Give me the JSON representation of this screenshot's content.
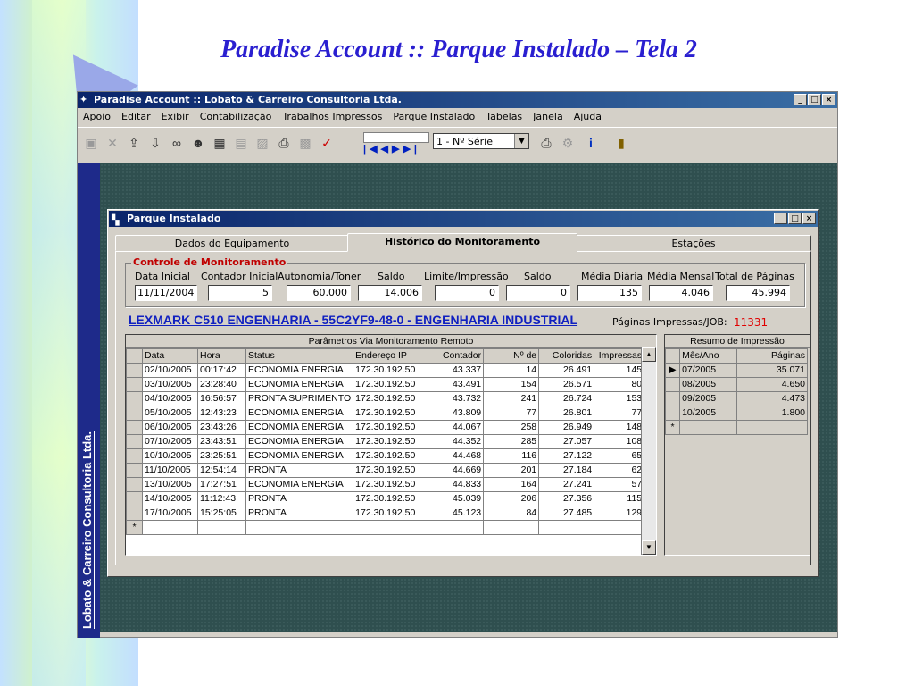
{
  "slide": {
    "title": "Paradise Account :: Parque Instalado – Tela 2"
  },
  "app": {
    "title": "Paradise Account :: Lobato & Carreiro Consultoria Ltda.",
    "side_label": "Lobato & Carreiro Consultoria Ltda.",
    "menu": [
      "Apoio",
      "Editar",
      "Exibir",
      "Contabilização",
      "Trabalhos Impressos",
      "Parque Instalado",
      "Tabelas",
      "Janela",
      "Ajuda"
    ],
    "combo_value": "1 - Nº Série",
    "window_buttons": [
      "_",
      "□",
      "×"
    ]
  },
  "child": {
    "title": "Parque Instalado",
    "tabs": [
      "Dados do Equipamento",
      "Histórico do Monitoramento",
      "Estações"
    ],
    "group_title": "Controle de Monitoramento",
    "fields": [
      {
        "label": "Data Inicial",
        "value": "11/11/2004"
      },
      {
        "label": "Contador Inicial",
        "value": "5"
      },
      {
        "label": "Autonomia/Toner",
        "value": "60.000"
      },
      {
        "label": "Saldo",
        "value": "14.006"
      },
      {
        "label": "Limite/Impressão",
        "value": "0"
      },
      {
        "label": "Saldo",
        "value": "0"
      },
      {
        "label": "Média Diária",
        "value": "135"
      },
      {
        "label": "Média Mensal",
        "value": "4.046"
      },
      {
        "label": "Total de Páginas",
        "value": "45.994"
      }
    ],
    "device": "LEXMARK C510 ENGENHARIA - 55C2YF9-48-0 - ENGENHARIA INDUSTRIAL",
    "pages_per_job_label": "Páginas Impressas/JOB:",
    "pages_per_job_value": "11331"
  },
  "monitor_grid": {
    "caption": "Parâmetros Via Monitoramento Remoto",
    "columns": [
      "Data",
      "Hora",
      "Status",
      "Endereço IP",
      "Contador",
      "Nº de",
      "Coloridas",
      "Impressas"
    ],
    "rows": [
      [
        "02/10/2005",
        "00:17:42",
        "ECONOMIA ENERGIA",
        "172.30.192.50",
        "43.337",
        "14",
        "26.491",
        "145"
      ],
      [
        "03/10/2005",
        "23:28:40",
        "ECONOMIA ENERGIA",
        "172.30.192.50",
        "43.491",
        "154",
        "26.571",
        "80"
      ],
      [
        "04/10/2005",
        "16:56:57",
        "PRONTA SUPRIMENTO",
        "172.30.192.50",
        "43.732",
        "241",
        "26.724",
        "153"
      ],
      [
        "05/10/2005",
        "12:43:23",
        "ECONOMIA ENERGIA",
        "172.30.192.50",
        "43.809",
        "77",
        "26.801",
        "77"
      ],
      [
        "06/10/2005",
        "23:43:26",
        "ECONOMIA ENERGIA",
        "172.30.192.50",
        "44.067",
        "258",
        "26.949",
        "148"
      ],
      [
        "07/10/2005",
        "23:43:51",
        "ECONOMIA ENERGIA",
        "172.30.192.50",
        "44.352",
        "285",
        "27.057",
        "108"
      ],
      [
        "10/10/2005",
        "23:25:51",
        "ECONOMIA ENERGIA",
        "172.30.192.50",
        "44.468",
        "116",
        "27.122",
        "65"
      ],
      [
        "11/10/2005",
        "12:54:14",
        "PRONTA",
        "172.30.192.50",
        "44.669",
        "201",
        "27.184",
        "62"
      ],
      [
        "13/10/2005",
        "17:27:51",
        "ECONOMIA ENERGIA",
        "172.30.192.50",
        "44.833",
        "164",
        "27.241",
        "57"
      ],
      [
        "14/10/2005",
        "11:12:43",
        "PRONTA",
        "172.30.192.50",
        "45.039",
        "206",
        "27.356",
        "115"
      ],
      [
        "17/10/2005",
        "15:25:05",
        "PRONTA",
        "172.30.192.50",
        "45.123",
        "84",
        "27.485",
        "129"
      ]
    ],
    "new_row_marker": "*"
  },
  "summary_grid": {
    "caption": "Resumo de Impressão",
    "columns": [
      "Mês/Ano",
      "Páginas"
    ],
    "rows": [
      [
        "07/2005",
        "35.071"
      ],
      [
        "08/2005",
        "4.650"
      ],
      [
        "09/2005",
        "4.473"
      ],
      [
        "10/2005",
        "1.800"
      ]
    ],
    "current_marker": "▶",
    "new_row_marker": "*"
  }
}
